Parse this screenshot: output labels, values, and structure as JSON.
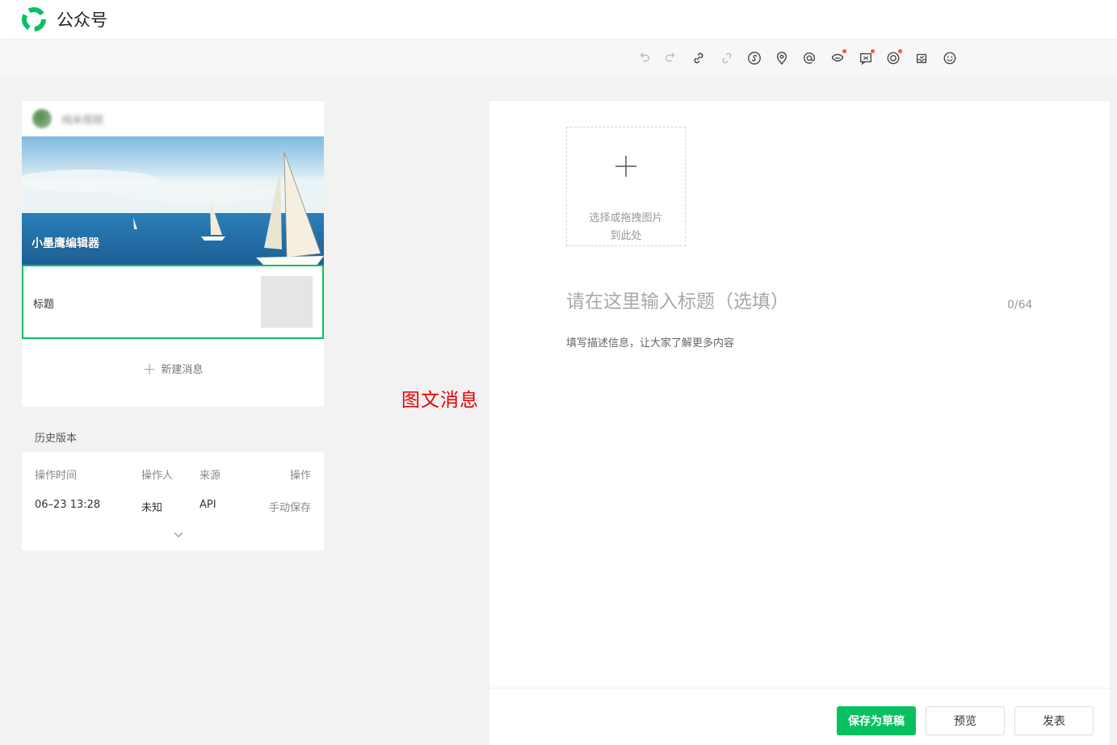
{
  "header": {
    "brand": "公众号",
    "accent_color": "#07c160"
  },
  "toolbar": {
    "tools": [
      {
        "name": "undo-icon",
        "has_dot": false
      },
      {
        "name": "redo-icon",
        "has_dot": false
      },
      {
        "name": "link-icon",
        "has_dot": false
      },
      {
        "name": "unlink-icon",
        "has_dot": false
      },
      {
        "name": "mini-program-icon",
        "has_dot": false
      },
      {
        "name": "location-icon",
        "has_dot": false
      },
      {
        "name": "mention-icon",
        "has_dot": false
      },
      {
        "name": "face-card-icon",
        "has_dot": true
      },
      {
        "name": "comment-icon",
        "has_dot": true
      },
      {
        "name": "circle-icon",
        "has_dot": true
      },
      {
        "name": "inbox-icon",
        "has_dot": false
      },
      {
        "name": "emoji-icon",
        "has_dot": false
      }
    ]
  },
  "article_list": {
    "account_name": "纯米视频",
    "cover_title": "小墨鹰编辑器",
    "item_title": "标题",
    "new_message": "新建消息"
  },
  "history": {
    "title": "历史版本",
    "columns": [
      "操作时间",
      "操作人",
      "来源",
      "操作"
    ],
    "rows": [
      {
        "time": "06–23 13:28",
        "operator": "未知",
        "source": "API",
        "action": "手动保存"
      }
    ]
  },
  "annotation": "图文消息",
  "editor": {
    "cover_upload_line1": "选择或拖拽图片",
    "cover_upload_line2": "到此处",
    "title_placeholder": "请在这里输入标题（选填）",
    "title_counter": "0/64",
    "description_placeholder": "填写描述信息，让大家了解更多内容"
  },
  "actions": {
    "save_draft": "保存为草稿",
    "preview": "预览",
    "publish": "发表"
  }
}
